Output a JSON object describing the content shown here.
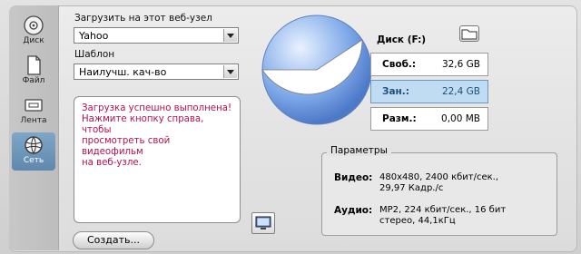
{
  "sidebar": {
    "items": [
      {
        "label": "Диск",
        "icon": "disc-icon"
      },
      {
        "label": "Файл",
        "icon": "file-icon"
      },
      {
        "label": "Лента",
        "icon": "tape-icon"
      },
      {
        "label": "Сеть",
        "icon": "network-icon"
      }
    ],
    "active": 3
  },
  "upload": {
    "label": "Загрузить на этот веб-узел",
    "value": "Yahoo"
  },
  "template": {
    "label": "Шаблон",
    "value": "Наилучш. кач-во"
  },
  "message": {
    "lines": [
      "Загрузка успешно выполнена!",
      "Нажмите кнопку справа, чтобы",
      "просмотреть свой видеофильм",
      "на веб-узле."
    ]
  },
  "create_button": "Создать...",
  "disk": {
    "title": "Диск (F:)",
    "free": {
      "label": "Своб.:",
      "value": "32,6 GB"
    },
    "used": {
      "label": "Зан.:",
      "value": "22,4 GB"
    },
    "size": {
      "label": "Разм.:",
      "value": "0,00 MB"
    },
    "used_fraction": 0.407
  },
  "params": {
    "title": "Параметры",
    "video": {
      "label": "Видео:",
      "value_lines": [
        "480x480, 2400 кбит/сек.,",
        "29,97 Кадр./с"
      ]
    },
    "audio": {
      "label": "Аудио:",
      "value_lines": [
        "MP2, 224 кбит/сек., 16 бит",
        "стерео, 44,1кГц"
      ]
    }
  },
  "colors": {
    "accent": "#5f88ad",
    "message": "#b0134f",
    "pie_free": "#6a93d6",
    "pie_used": "#ffffff"
  }
}
